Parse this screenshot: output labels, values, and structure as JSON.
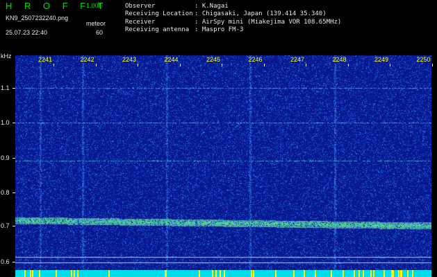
{
  "header": {
    "title": "H R O F F T",
    "version": "1.00f",
    "filename": "KN9_2507232240.png",
    "meteor_label": "meteor",
    "timestamp": "25.07.23 22:40",
    "count": "60"
  },
  "meta": {
    "rows": [
      {
        "label": "Observer",
        "value": ": K.Nagai"
      },
      {
        "label": "Receiving Location",
        "value": ": Chigasaki, Japan (139.414 35.340)"
      },
      {
        "label": "Receiver",
        "value": ": AirSpy mini (Miakejima VOR 108.65MHz)"
      },
      {
        "label": "Receiving antenna",
        "value": ": Maspro FM-3"
      }
    ]
  },
  "axes": {
    "y_unit": "kHz",
    "y_ticks": [
      "1.1",
      "1.0",
      "0.9",
      "0.8",
      "0.7",
      "0.6"
    ],
    "x_ticks": [
      "2241",
      "2242",
      "2243",
      "2244",
      "2245",
      "2246",
      "2247",
      "2248",
      "2249",
      "2250"
    ]
  },
  "colors": {
    "background": "#0a1c8a",
    "title_green": "#00e000",
    "label_yellow": "#ffff00",
    "signal_green": "#7cf07c",
    "strip_cyan": "#00dde8"
  }
}
